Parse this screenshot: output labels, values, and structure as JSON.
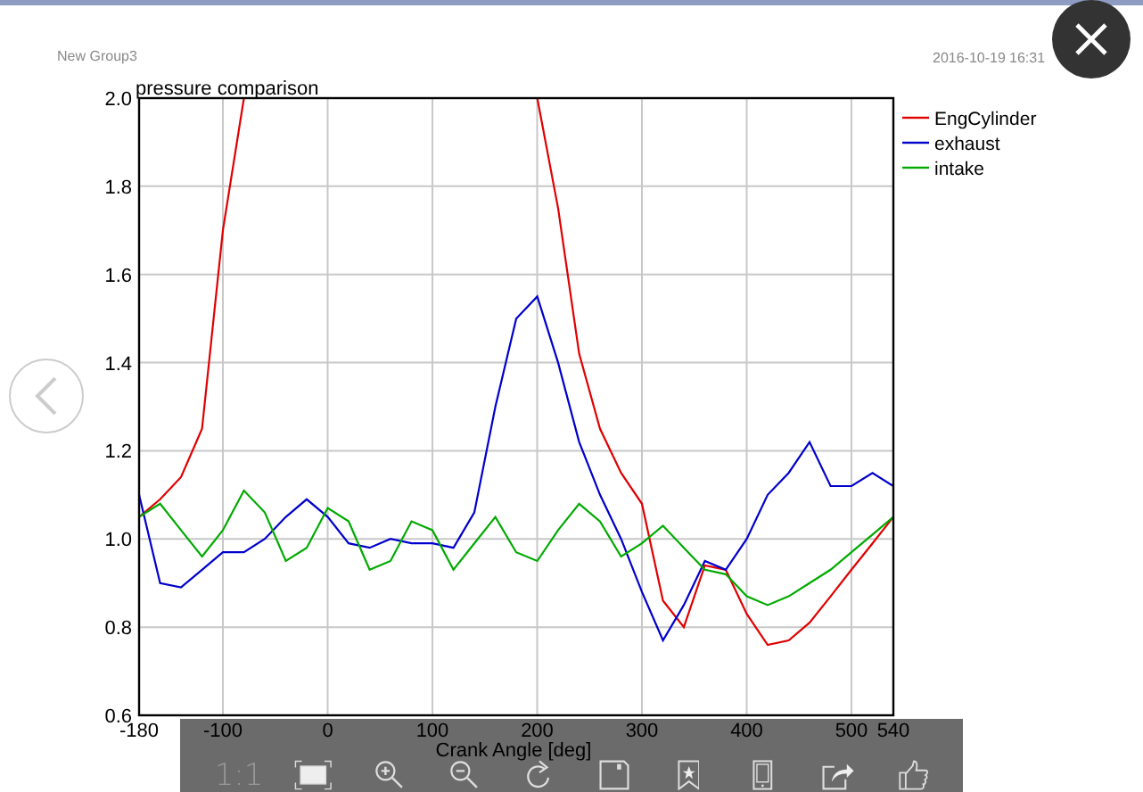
{
  "header": {
    "group": "New Group3",
    "date": "2016-10-19",
    "time": "16:31"
  },
  "chart": {
    "chart_data": {
      "type": "line",
      "title": "pressure comparison",
      "xlabel": "Crank Angle [deg]",
      "x": [
        -180,
        -160,
        -140,
        -120,
        -100,
        -80,
        -60,
        -40,
        -20,
        0,
        20,
        40,
        60,
        80,
        100,
        120,
        140,
        160,
        180,
        200,
        220,
        240,
        260,
        280,
        300,
        320,
        340,
        360,
        380,
        400,
        420,
        440,
        460,
        480,
        500,
        520,
        540
      ],
      "series": [
        {
          "name": "EngCylinder",
          "color": "#e00000",
          "values": [
            1.05,
            1.09,
            1.14,
            1.25,
            1.7,
            2.0,
            null,
            null,
            null,
            null,
            null,
            null,
            null,
            null,
            null,
            null,
            null,
            null,
            null,
            2.0,
            1.75,
            1.42,
            1.25,
            1.15,
            1.08,
            0.86,
            0.8,
            0.94,
            0.93,
            0.83,
            0.76,
            0.77,
            0.81,
            0.87,
            0.93,
            0.99,
            1.05
          ]
        },
        {
          "name": "exhaust",
          "color": "#0000cc",
          "values": [
            1.1,
            0.9,
            0.89,
            0.93,
            0.97,
            0.97,
            1.0,
            1.05,
            1.09,
            1.05,
            0.99,
            0.98,
            1.0,
            0.99,
            0.99,
            0.98,
            1.06,
            1.3,
            1.5,
            1.55,
            1.4,
            1.22,
            1.1,
            1.0,
            0.88,
            0.77,
            0.85,
            0.95,
            0.93,
            1.0,
            1.1,
            1.15,
            1.22,
            1.12,
            1.12,
            1.15,
            1.12
          ]
        },
        {
          "name": "intake",
          "color": "#00aa00",
          "values": [
            1.05,
            1.08,
            1.02,
            0.96,
            1.02,
            1.11,
            1.06,
            0.95,
            0.98,
            1.07,
            1.04,
            0.93,
            0.95,
            1.04,
            1.02,
            0.93,
            0.99,
            1.05,
            0.97,
            0.95,
            1.02,
            1.08,
            1.04,
            0.96,
            0.99,
            1.03,
            0.98,
            0.93,
            0.92,
            0.87,
            0.85,
            0.87,
            0.9,
            0.93,
            0.97,
            1.01,
            1.05
          ]
        }
      ],
      "grid": true,
      "legend": true,
      "xlim": [
        -180,
        540
      ],
      "ylim": [
        0.6,
        2.0
      ],
      "xticks": [
        -180,
        -100,
        0,
        100,
        200,
        300,
        400,
        500,
        540
      ],
      "yticks": [
        {
          "value": 0.6,
          "label": "0.6"
        },
        {
          "value": 0.8,
          "label": "0.8"
        },
        {
          "value": 1.0,
          "label": "1.0"
        },
        {
          "value": 1.2,
          "label": "1.2"
        },
        {
          "value": 1.4,
          "label": "1.4"
        },
        {
          "value": 1.6,
          "label": "1.6"
        },
        {
          "value": 1.8,
          "label": "1.8"
        },
        {
          "value": 2.0,
          "label": "2.0"
        }
      ]
    }
  },
  "toolbar": {
    "actual_size": "1:1"
  }
}
